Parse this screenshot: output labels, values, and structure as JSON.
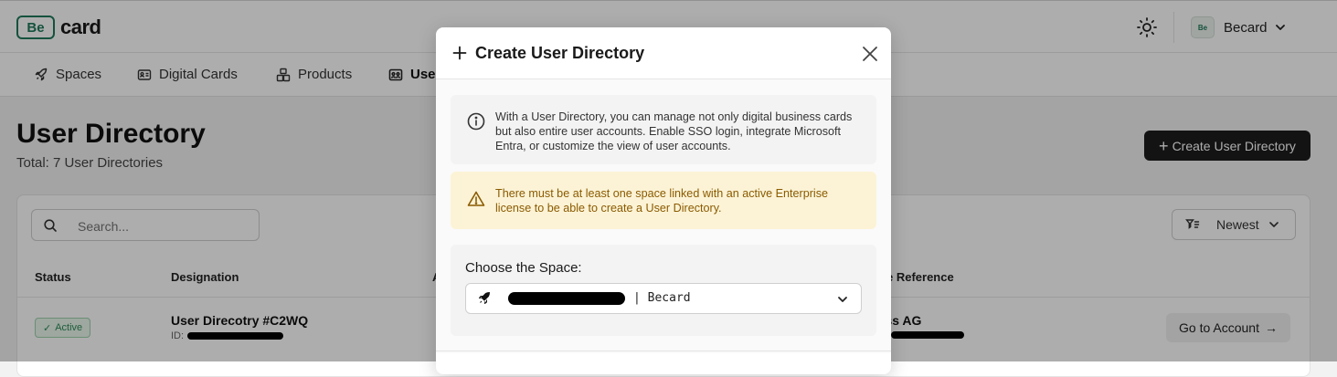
{
  "app": {
    "logo_mark": "Be",
    "logo_word": "card",
    "account_name": "Becard",
    "account_avatar_text": "Be"
  },
  "nav": {
    "items": [
      {
        "label": "Spaces",
        "icon": "rocket-icon"
      },
      {
        "label": "Digital Cards",
        "icon": "id-card-icon"
      },
      {
        "label": "Products",
        "icon": "boxes-icon"
      },
      {
        "label": "Use",
        "icon": "users-icon"
      }
    ]
  },
  "page": {
    "title": "User Directory",
    "subtitle": "Total: 7 User Directories",
    "create_button": "Create User Directory",
    "search_placeholder": "Search...",
    "sort_label": "Newest",
    "columns": [
      "Status",
      "Designation",
      "A",
      "e Reference"
    ],
    "rows": [
      {
        "status": "Active",
        "designation": "User Direcotry #C2WQ",
        "id_prefix": "ID:",
        "reference": "nance Swiss AG",
        "action": "Go to Account"
      }
    ]
  },
  "modal": {
    "title": "Create User Directory",
    "info_text": "With a User Directory, you can manage not only digital business cards but also entire user accounts. Enable SSO login, integrate Microsoft Entra, or customize the view of user accounts.",
    "warning_text": "There must be at least one space linked with an active Enterprise license to be able to create a User Directory.",
    "choose_label": "Choose the Space:",
    "select_value": "| Becard"
  },
  "colors": {
    "brand_green": "#1f7a5a",
    "primary_button": "#1c1c1c",
    "warning_bg": "#fcf3d6",
    "warning_text": "#8a5a00",
    "active_badge": "#2e8b57"
  }
}
